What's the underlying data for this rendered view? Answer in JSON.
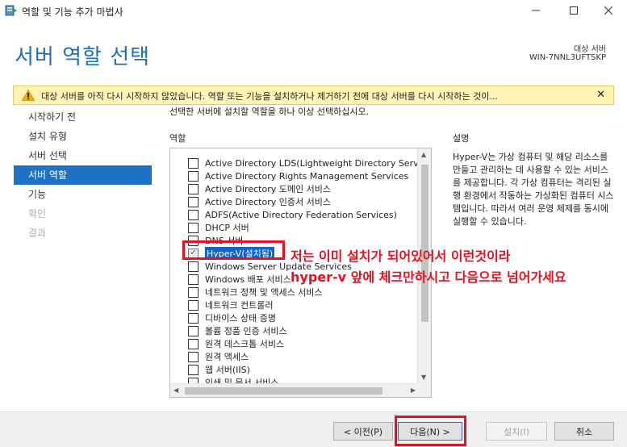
{
  "window": {
    "title": "역할 및 기능 추가 마법사",
    "buttons": [
      "minimize",
      "maximize",
      "close"
    ]
  },
  "header": {
    "page_title": "서버 역할 선택",
    "destination_label": "대상 서버",
    "destination_server": "WIN-7NNL3UFTSKP"
  },
  "warning": {
    "text": "대상 서버를 아직 다시 시작하지 않았습니다. 역할 또는 기능을 설치하거나 제거하기 전에 대상 서버를 다시 시작하는 것이...",
    "close_label": "✕"
  },
  "nav": {
    "items": [
      {
        "label": "시작하기 전",
        "state": "normal"
      },
      {
        "label": "설치 유형",
        "state": "normal"
      },
      {
        "label": "서버 선택",
        "state": "normal"
      },
      {
        "label": "서버 역할",
        "state": "active"
      },
      {
        "label": "기능",
        "state": "normal"
      },
      {
        "label": "확인",
        "state": "disabled"
      },
      {
        "label": "결과",
        "state": "disabled"
      }
    ]
  },
  "main": {
    "instruction": "선택한 서버에 설치할 역할을 하나 이상 선택하십시오.",
    "roles_label": "역할",
    "description_label": "설명",
    "description_text": "Hyper-V는 가상 컴퓨터 및 해당 리소스를 만들고 관리하는 데 사용할 수 있는 서비스를 제공합니다. 각 가상 컴퓨터는 격리된 실행 환경에서 작동하는 가상화된 컴퓨터 시스템입니다. 따라서 여러 운영 체제를 동시에 실행할 수 있습니다."
  },
  "roles": [
    {
      "label": "Active Directory LDS(Lightweight Directory Servic",
      "checked": false,
      "selected": false
    },
    {
      "label": "Active Directory Rights Management Services",
      "checked": false,
      "selected": false
    },
    {
      "label": "Active Directory 도메인 서비스",
      "checked": false,
      "selected": false
    },
    {
      "label": "Active Directory 인증서 서비스",
      "checked": false,
      "selected": false
    },
    {
      "label": "ADFS(Active Directory Federation Services)",
      "checked": false,
      "selected": false
    },
    {
      "label": "DHCP 서버",
      "checked": false,
      "selected": false
    },
    {
      "label": "DNS 서버",
      "checked": false,
      "selected": false
    },
    {
      "label": "Hyper-V(설치됨)",
      "checked": true,
      "selected": true
    },
    {
      "label": "Windows Server Update Services",
      "checked": false,
      "selected": false
    },
    {
      "label": "Windows 배포 서비스",
      "checked": false,
      "selected": false
    },
    {
      "label": "네트워크 정책 및 액세스 서비스",
      "checked": false,
      "selected": false
    },
    {
      "label": "네트워크 컨트롤러",
      "checked": false,
      "selected": false
    },
    {
      "label": "디바이스 상태 증명",
      "checked": false,
      "selected": false
    },
    {
      "label": "볼륨 정품 인증 서비스",
      "checked": false,
      "selected": false
    },
    {
      "label": "원격 데스크톱 서비스",
      "checked": false,
      "selected": false
    },
    {
      "label": "원격 액세스",
      "checked": false,
      "selected": false
    },
    {
      "label": "웹 서버(IIS)",
      "checked": false,
      "selected": false
    },
    {
      "label": "인쇄 및 문서 서비스",
      "checked": false,
      "selected": false
    }
  ],
  "annotation": {
    "line1": "저는 이미 설치가 되어있어서 이런것이라",
    "line2": "hyper-v 앞에 체크만하시고 다음으로 넘어가세요",
    "color": "#e81020"
  },
  "footer": {
    "prev_label": "< 이전(P)",
    "next_label": "다음(N) >",
    "install_label": "설치(I)",
    "cancel_label": "취소"
  },
  "colors": {
    "accent": "#1e72c6",
    "title_blue": "#1d6fb8",
    "warning_bg": "#fff4b6"
  }
}
